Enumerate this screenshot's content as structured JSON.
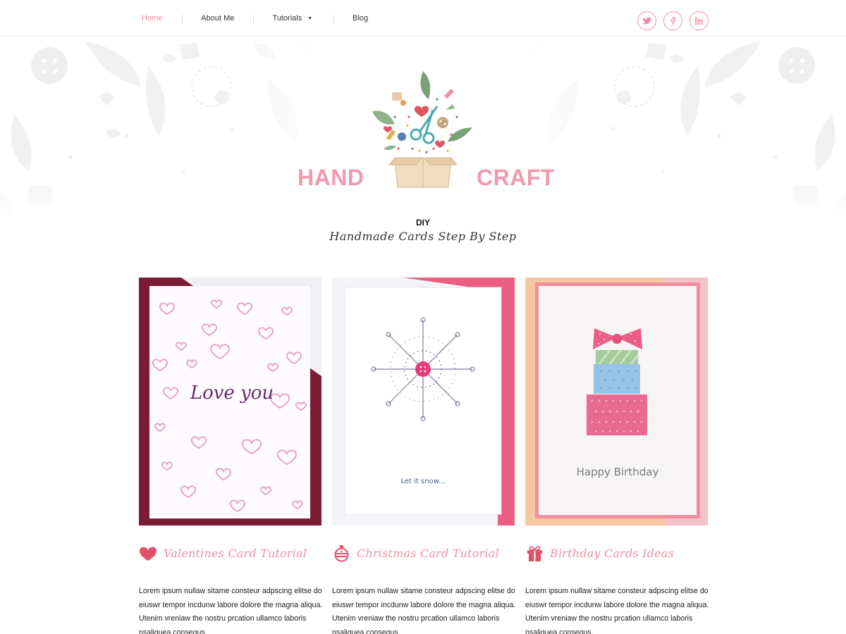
{
  "nav": {
    "items": [
      {
        "label": "Home",
        "active": true
      },
      {
        "label": "About Me",
        "active": false
      },
      {
        "label": "Tutorials",
        "active": false,
        "has_dropdown": true
      },
      {
        "label": "Blog",
        "active": false
      }
    ],
    "social": [
      "twitter-icon",
      "facebook-icon",
      "linkedin-icon"
    ]
  },
  "hero": {
    "logo_left": "HAND",
    "logo_right": "CRAFT",
    "tagline": "DIY",
    "subtitle": "Handmade Cards Step By Step"
  },
  "cards": [
    {
      "title": "Valentines Card Tutorial",
      "icon": "heart-icon",
      "image_text": "Love you",
      "text": "Lorem ipsum nullaw sitame consteur adpscing elitse do eiuswr tempor incdunw labore dolore the magna aliqua. Utenim vreniaw the nostru prcation ullamco laboris nsaliquea consequs."
    },
    {
      "title": "Christmas Card Tutorial",
      "icon": "ornament-icon",
      "image_text": "Let it snow...",
      "text": "Lorem ipsum nullaw sitame consteur adpscing elitse do eiuswr tempor incdunw labore dolore the magna aliqua. Utenim vreniaw the nostru prcation ullamco laboris nsaliquea consequs."
    },
    {
      "title": "Birthday Cards Ideas",
      "icon": "gift-icon",
      "image_text": "Happy Birthday",
      "text": "Lorem ipsum nullaw sitame consteur adpscing elitse do eiuswr tempor incdunw labore dolore the magna aliqua. Utenim vreniaw the nostru prcation ullamco laboris nsaliquea consequs."
    }
  ],
  "colors": {
    "accent": "#ef8fa6",
    "text": "#1d1d1d",
    "nav_border": "#ececec"
  }
}
